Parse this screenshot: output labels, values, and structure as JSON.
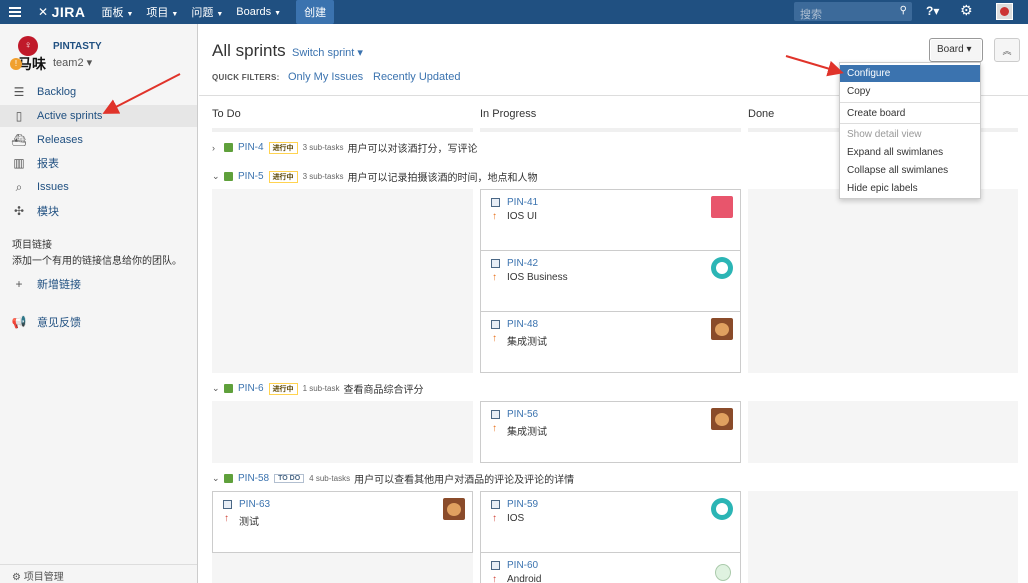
{
  "topnav": {
    "logo": "JIRA",
    "items": [
      {
        "label": "面板"
      },
      {
        "label": "项目"
      },
      {
        "label": "问题"
      },
      {
        "label": "Boards"
      }
    ],
    "create_label": "创建",
    "search_placeholder": "搜索"
  },
  "sidebar": {
    "project_name": "PINTASTY",
    "team": "team2",
    "logo_text": "马味",
    "nav": [
      {
        "label": "Backlog",
        "icon": "backlog-icon"
      },
      {
        "label": "Active sprints",
        "icon": "board-icon",
        "active": true
      },
      {
        "label": "Releases",
        "icon": "releases-icon"
      },
      {
        "label": "报表",
        "icon": "reports-icon"
      },
      {
        "label": "Issues",
        "icon": "issues-icon"
      },
      {
        "label": "模块",
        "icon": "components-icon"
      }
    ],
    "links_heading": "项目链接",
    "links_text": "添加一个有用的链接信息给你的团队。",
    "add_link_label": "新增链接",
    "feedback_label": "意见反馈",
    "footer_label": "项目管理"
  },
  "main": {
    "title": "All sprints",
    "switch_sprint": "Switch sprint",
    "quick_filters_label": "QUICK FILTERS:",
    "quick_filters": [
      "Only My Issues",
      "Recently Updated"
    ],
    "board_button": "Board",
    "columns": [
      "To Do",
      "In Progress",
      "Done"
    ]
  },
  "swimlanes": [
    {
      "key": "PIN-4",
      "status": "进行中",
      "status_type": "in-progress",
      "subtasks": "3 sub-tasks",
      "summary": "用户可以对该酒打分，写评论",
      "expanded": false
    },
    {
      "key": "PIN-5",
      "status": "进行中",
      "status_type": "in-progress",
      "subtasks": "3 sub-tasks",
      "summary": "用户可以记录拍摄该酒的时间，地点和人物",
      "expanded": true
    },
    {
      "key": "PIN-6",
      "status": "进行中",
      "status_type": "in-progress",
      "subtasks": "1 sub-task",
      "summary": "查看商品综合评分",
      "expanded": true
    },
    {
      "key": "PIN-58",
      "status": "TO DO",
      "status_type": "todo",
      "subtasks": "4 sub-tasks",
      "summary": "用户可以查看其他用户对酒品的评论及评论的详情",
      "expanded": true
    }
  ],
  "cards": [
    {
      "key": "PIN-41",
      "summary": "IOS UI",
      "priority": "major",
      "avatar": "pink"
    },
    {
      "key": "PIN-42",
      "summary": "IOS Business",
      "priority": "major",
      "avatar": "teal"
    },
    {
      "key": "PIN-48",
      "summary": "集成测试",
      "priority": "major",
      "avatar": "photo"
    },
    {
      "key": "PIN-56",
      "summary": "集成测试",
      "priority": "major",
      "avatar": "photo"
    },
    {
      "key": "PIN-63",
      "summary": "测试",
      "priority": "critical",
      "avatar": "photo"
    },
    {
      "key": "PIN-59",
      "summary": "IOS",
      "priority": "critical",
      "avatar": "teal"
    },
    {
      "key": "PIN-60",
      "summary": "Android",
      "priority": "critical",
      "avatar": "green"
    }
  ],
  "board_menu": {
    "items": [
      {
        "label": "Configure",
        "highlighted": true
      },
      {
        "label": "Copy"
      },
      {
        "label": "Create board"
      },
      {
        "label": "Show detail view",
        "disabled": true
      },
      {
        "label": "Expand all swimlanes"
      },
      {
        "label": "Collapse all swimlanes"
      },
      {
        "label": "Hide epic labels"
      }
    ]
  },
  "colors": {
    "nav_bg": "#205081",
    "link": "#3b73af",
    "story_green": "#5fa03b",
    "annotation_red": "#e0332a"
  }
}
